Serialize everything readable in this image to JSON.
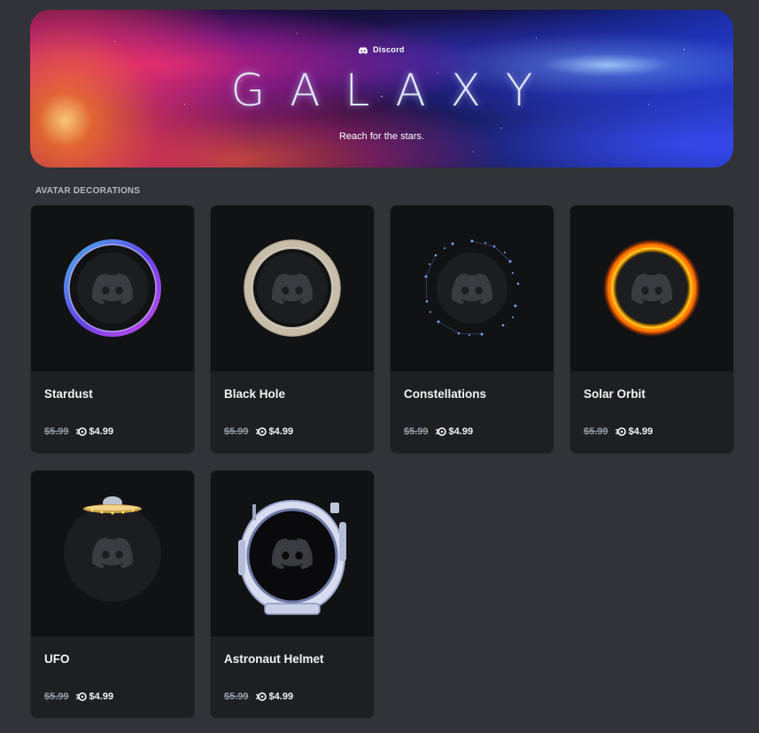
{
  "banner": {
    "brand": "Discord",
    "title": "GALAXY",
    "subtitle": "Reach for the stars."
  },
  "section": {
    "label": "AVATAR DECORATIONS"
  },
  "items": [
    {
      "name": "Stardust",
      "old_price": "$5.99",
      "price": "$4.99",
      "deco": "stardust"
    },
    {
      "name": "Black Hole",
      "old_price": "$5.99",
      "price": "$4.99",
      "deco": "black-hole"
    },
    {
      "name": "Constellations",
      "old_price": "$5.99",
      "price": "$4.99",
      "deco": "constellations"
    },
    {
      "name": "Solar Orbit",
      "old_price": "$5.99",
      "price": "$4.99",
      "deco": "solar-orbit"
    },
    {
      "name": "UFO",
      "old_price": "$5.99",
      "price": "$4.99",
      "deco": "ufo"
    },
    {
      "name": "Astronaut Helmet",
      "old_price": "$5.99",
      "price": "$4.99",
      "deco": "astronaut-helmet"
    }
  ],
  "colors": {
    "background": "#313338",
    "card_top": "#111214",
    "card_bottom": "#1e1f22",
    "text": "#f2f3f5",
    "muted": "#949ba4"
  },
  "icons": [
    "discord-logo-icon",
    "nitro-icon"
  ]
}
